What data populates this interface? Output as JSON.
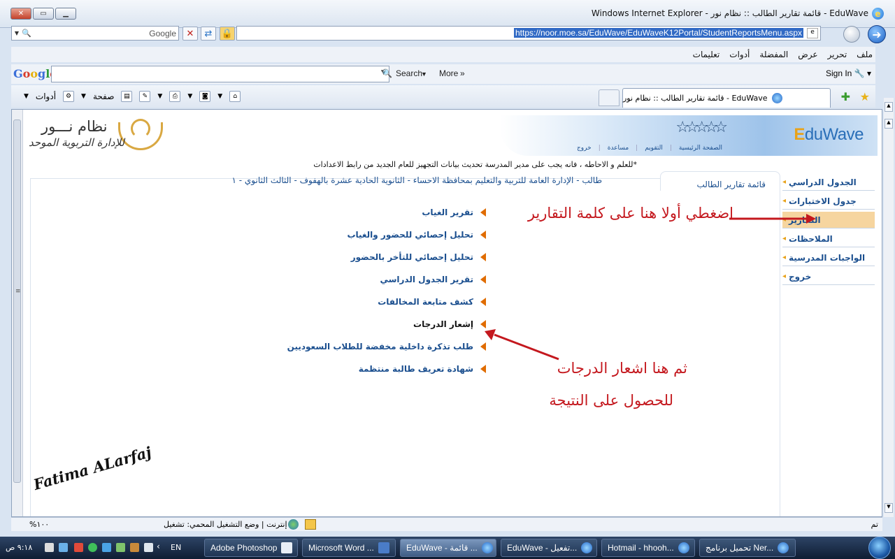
{
  "window": {
    "title": "EduWave - قائمة تقارير الطالب :: نظام نور - Windows Internet Explorer"
  },
  "addressbar": {
    "url": "https://noor.moe.sa/EduWave/EduWaveK12Portal/StudentReportsMenu.aspx",
    "search_placeholder": "Google"
  },
  "menubar": [
    "ملف",
    "تحرير",
    "عرض",
    "المفضلة",
    "أدوات",
    "تعليمات"
  ],
  "google_toolbar": {
    "logo": "Google",
    "search_label": "Search",
    "more_label": "More",
    "signin_label": "Sign In"
  },
  "commandbar": {
    "page_label": "صفحة",
    "tools_label": "أدوات"
  },
  "tab": {
    "title": "EduWave - قائمة تقارير الطالب :: نظام نور"
  },
  "header": {
    "brand": "EduWave",
    "brand_initial": "E",
    "brand_rest": "duWave",
    "noor_title": "نظام نـــور",
    "noor_subtitle": "للإدارة التربوية الموحد",
    "links": [
      "الصفحة الرئيسية",
      "التقويم",
      "مساعدة",
      "خروج"
    ]
  },
  "notice": "*للعلم و الاحاطه ، فانه يجب على مدير المدرسة تحديث بيانات التجهيز للعام الجديد من رابط الاعدادات",
  "panel": {
    "title": "قائمة تقارير الطالب",
    "student_line": "طالب - الإدارة العامة للتربية والتعليم بمحافظة الاحساء - الثانوية الحادية عشرة بالهفوف - الثالث الثانوي - ١"
  },
  "reports": [
    {
      "label": "تقرير الغياب"
    },
    {
      "label": "تحليل إحصائي للحضور والغياب"
    },
    {
      "label": "تحليل إحصائي للتأخر بالحضور"
    },
    {
      "label": "تقرير الجدول الدراسي"
    },
    {
      "label": "كشف متابعة المخالفات"
    },
    {
      "label": "إشعار الدرجات"
    },
    {
      "label": "طلب تذكرة داخلية مخفضة للطلاب السعوديين"
    },
    {
      "label": "شهادة تعريف طالبة منتظمة"
    }
  ],
  "sidenav": [
    {
      "label": "الجدول الدراسي"
    },
    {
      "label": "جدول الاختبارات"
    },
    {
      "label": "التقارير"
    },
    {
      "label": "الملاحظات"
    },
    {
      "label": "الواجبات المدرسية"
    },
    {
      "label": "خروج"
    }
  ],
  "annotations": {
    "first": "اضغطي أولا هنا على كلمة التقارير",
    "second_line1": "ثم هنا اشعار الدرجات",
    "second_line2": "للحصول على النتيجة",
    "signature": "Fatima ALarfaj"
  },
  "statusbar": {
    "done": "تم",
    "mode": "إنترنت | وضع التشغيل المحمي: تشغيل",
    "zoom": "١٠٠%"
  },
  "taskbar": {
    "tasks": [
      {
        "label": "Adobe Photoshop"
      },
      {
        "label": "Microsoft Word ..."
      },
      {
        "label": "EduWave - قائمة ..."
      },
      {
        "label": "EduWave - تفعيل..."
      },
      {
        "label": "Hotmail - hhooh..."
      },
      {
        "label": "تحميل برنامج Ner..."
      }
    ],
    "lang": "EN",
    "clock": "٩:١٨ ص"
  }
}
